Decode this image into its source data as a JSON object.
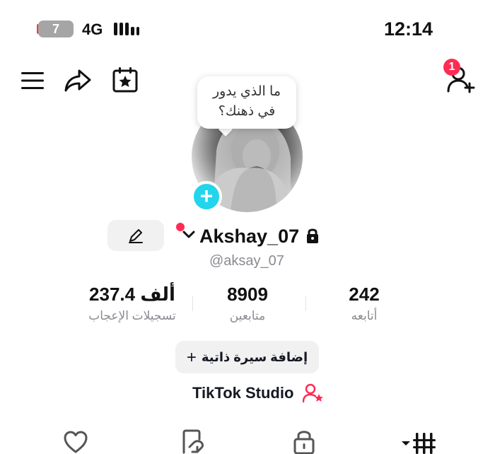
{
  "status_bar": {
    "battery_level": "7",
    "network": "4G",
    "time": "12:14"
  },
  "header": {
    "icons": [
      "menu-icon",
      "share-icon",
      "calendar-star-icon",
      "add-friend-icon"
    ],
    "notification_badge": "1"
  },
  "profile": {
    "bubble_text_line1": "ما الذي يدور",
    "bubble_text_line2": "في ذهنك؟",
    "display_name": "Akshay_07",
    "handle": "@aksay_07"
  },
  "stats": [
    {
      "value": "237.4 ألف",
      "label": "تسجيلات الإعجاب"
    },
    {
      "value": "8909",
      "label": "متابعين"
    },
    {
      "value": "242",
      "label": "أتابعه"
    }
  ],
  "bio_button": {
    "plus": "+",
    "label": "إضافة سيرة ذاتية"
  },
  "studio": {
    "label": "TikTok Studio"
  },
  "tabs": [
    "grid-icon",
    "lock-icon",
    "repost-icon",
    "heart-icon"
  ],
  "colors": {
    "accent": "#fe2c55",
    "teal": "#20d5ec",
    "muted": "#8a8b91",
    "chip_bg": "#f1f1f2"
  }
}
